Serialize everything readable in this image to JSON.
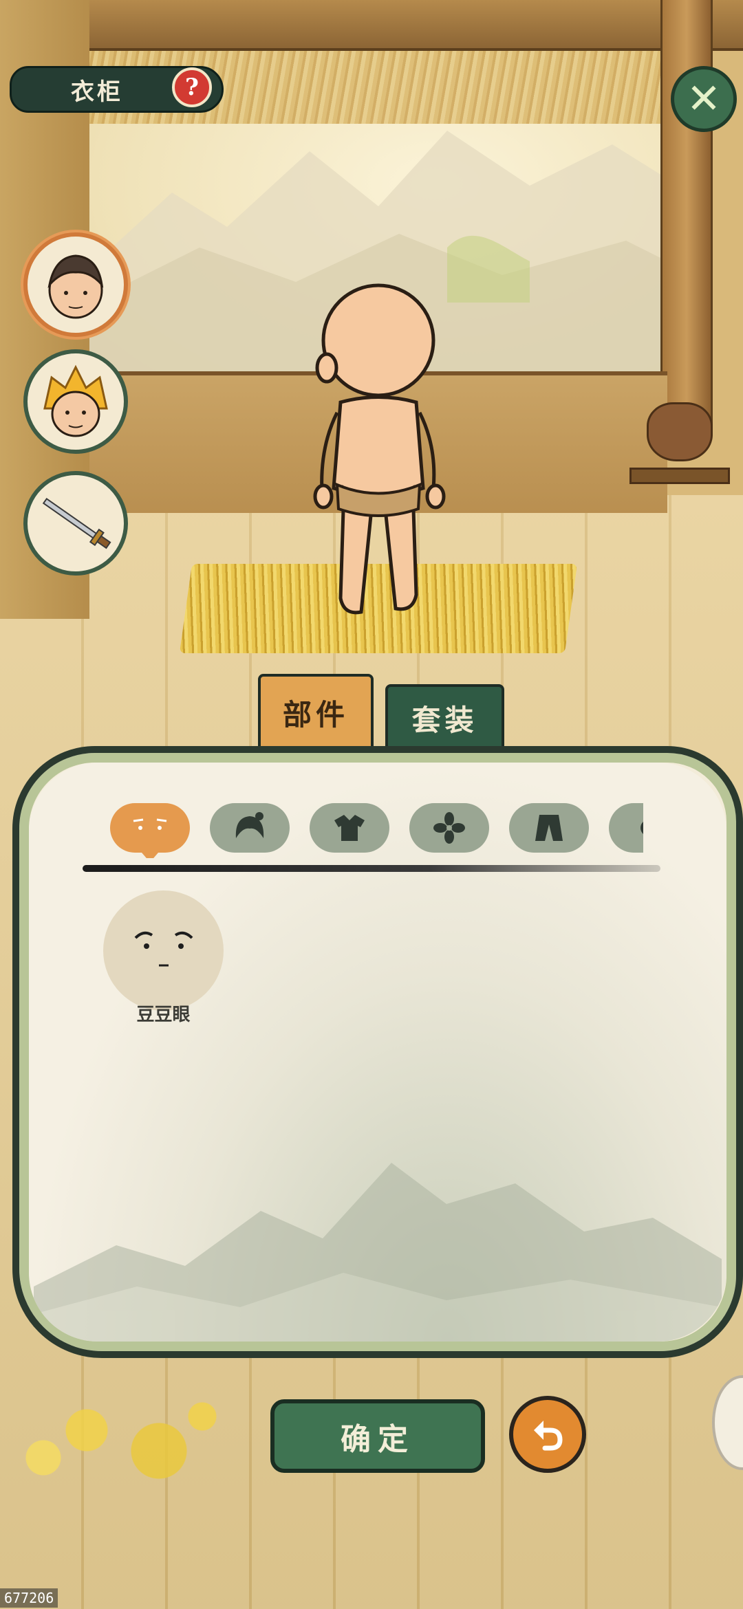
{
  "header": {
    "title": "衣柜",
    "help_glyph": "?",
    "close_glyph": "✕"
  },
  "side_buttons": [
    {
      "name": "character-male",
      "icon": "boy-portrait-icon",
      "active": true
    },
    {
      "name": "character-monkey",
      "icon": "monkey-king-portrait-icon",
      "active": false
    },
    {
      "name": "weapon",
      "icon": "sword-icon",
      "active": false
    }
  ],
  "tabs": [
    {
      "label": "部件",
      "active": true
    },
    {
      "label": "套装",
      "active": false
    }
  ],
  "categories": [
    {
      "icon": "face-eyes-icon",
      "active": true
    },
    {
      "icon": "hair-icon",
      "active": false
    },
    {
      "icon": "clothes-icon",
      "active": false
    },
    {
      "icon": "flower-accessory-icon",
      "active": false
    },
    {
      "icon": "pants-icon",
      "active": false
    },
    {
      "icon": "more-category-icon",
      "active": false
    }
  ],
  "items": [
    {
      "label": "豆豆眼",
      "icon": "bean-eyes-face-icon"
    }
  ],
  "footer": {
    "confirm_label": "确定",
    "undo_icon": "undo-arrow-icon"
  },
  "watermark": "677206",
  "colors": {
    "accent_orange": "#e59a4e",
    "accent_green": "#3f7452",
    "panel_border": "#2b3a2f"
  }
}
